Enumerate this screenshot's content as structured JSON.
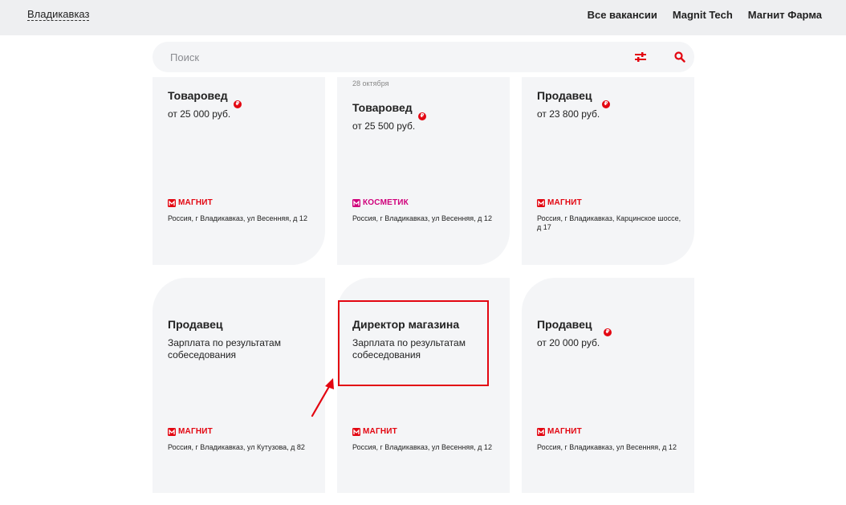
{
  "header": {
    "city": "Владикавказ",
    "nav": [
      "Все вакансии",
      "Magnit Tech",
      "Магнит Фарма"
    ]
  },
  "search": {
    "placeholder": "Поиск"
  },
  "currency_symbol": "₽",
  "colors": {
    "accent": "#e30611",
    "kosmetik": "#d0007b",
    "card_bg": "#f4f5f7",
    "topbar_bg": "#eeeff1"
  },
  "cards": [
    {
      "date": "",
      "title": "Товаровед",
      "salary": "от 25 000 руб.",
      "brand": "МАГНИТ",
      "brand_icon": "magnit-logo-icon",
      "address": "Россия, г Владикавказ, ул Весенняя, д 12"
    },
    {
      "date": "28 октября",
      "title": "Товаровед",
      "salary": "от 25 500 руб.",
      "brand": "КОСМЕТИК",
      "brand_icon": "magnit-kosmetik-logo-icon",
      "address": "Россия, г Владикавказ, ул Весенняя, д 12"
    },
    {
      "date": "",
      "title": "Продавец",
      "salary": "от 23 800 руб.",
      "brand": "МАГНИТ",
      "brand_icon": "magnit-logo-icon",
      "address": "Россия, г Владикавказ, Карцинское шоссе, д 17"
    },
    {
      "date": "",
      "title": "Продавец",
      "salary": "Зарплата по результатам собеседования",
      "brand": "МАГНИТ",
      "brand_icon": "magnit-logo-icon",
      "address": "Россия, г Владикавказ, ул Кутузова, д 82"
    },
    {
      "date": "",
      "title": "Директор магазина",
      "salary": "Зарплата по результатам собеседования",
      "brand": "МАГНИТ",
      "brand_icon": "magnit-logo-icon",
      "address": "Россия, г Владикавказ, ул Весенняя, д 12"
    },
    {
      "date": "",
      "title": "Продавец",
      "salary": "от 20 000 руб.",
      "brand": "МАГНИТ",
      "brand_icon": "magnit-logo-icon",
      "address": "Россия, г Владикавказ, ул Весенняя, д 12"
    }
  ]
}
